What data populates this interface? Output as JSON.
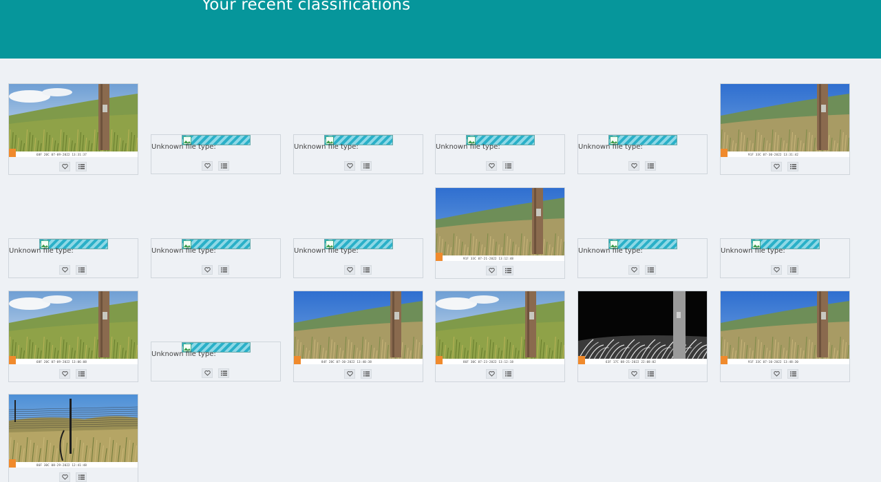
{
  "header": {
    "title": "Your recent classifications"
  },
  "unknown_label": "Unknown file type:",
  "colors": {
    "header_bg": "#06969b",
    "page_bg": "#eef1f5",
    "card_border": "#cfd5db"
  },
  "icons": {
    "favorite": "heart-icon",
    "collect": "list-icon",
    "broken": "broken-image-icon"
  },
  "classifications": [
    {
      "kind": "image",
      "scene": "grass-cloudy",
      "stamp": "68F 20C  07-09-2022  13:31:37"
    },
    {
      "kind": "unknown"
    },
    {
      "kind": "unknown"
    },
    {
      "kind": "unknown"
    },
    {
      "kind": "unknown"
    },
    {
      "kind": "image",
      "scene": "grass-blue",
      "stamp": "91F 33C  07-30-2022  13:31:42"
    },
    {
      "kind": "unknown"
    },
    {
      "kind": "unknown"
    },
    {
      "kind": "unknown"
    },
    {
      "kind": "image",
      "scene": "grass-blue",
      "stamp": "91F 33C  07-21-2022  13:12:48"
    },
    {
      "kind": "unknown"
    },
    {
      "kind": "unknown"
    },
    {
      "kind": "image",
      "scene": "grass-cloudy",
      "stamp": "68F 20C  07-09-2022  13:06:08"
    },
    {
      "kind": "unknown"
    },
    {
      "kind": "image",
      "scene": "grass-blue",
      "stamp": "84F 28C  07-30-2022  13:40:38"
    },
    {
      "kind": "image",
      "scene": "grass-cloudy",
      "stamp": "86F 30C  07-23-2022  13:12:18"
    },
    {
      "kind": "image",
      "scene": "night",
      "stamp": "63F 17C  08-21-2022  22:08:02"
    },
    {
      "kind": "image",
      "scene": "grass-blue",
      "stamp": "91F 33C  07-10-2022  13:48:30"
    },
    {
      "kind": "image",
      "scene": "fence",
      "stamp": "86F 30C  08-29-2022  12:41:48"
    }
  ]
}
